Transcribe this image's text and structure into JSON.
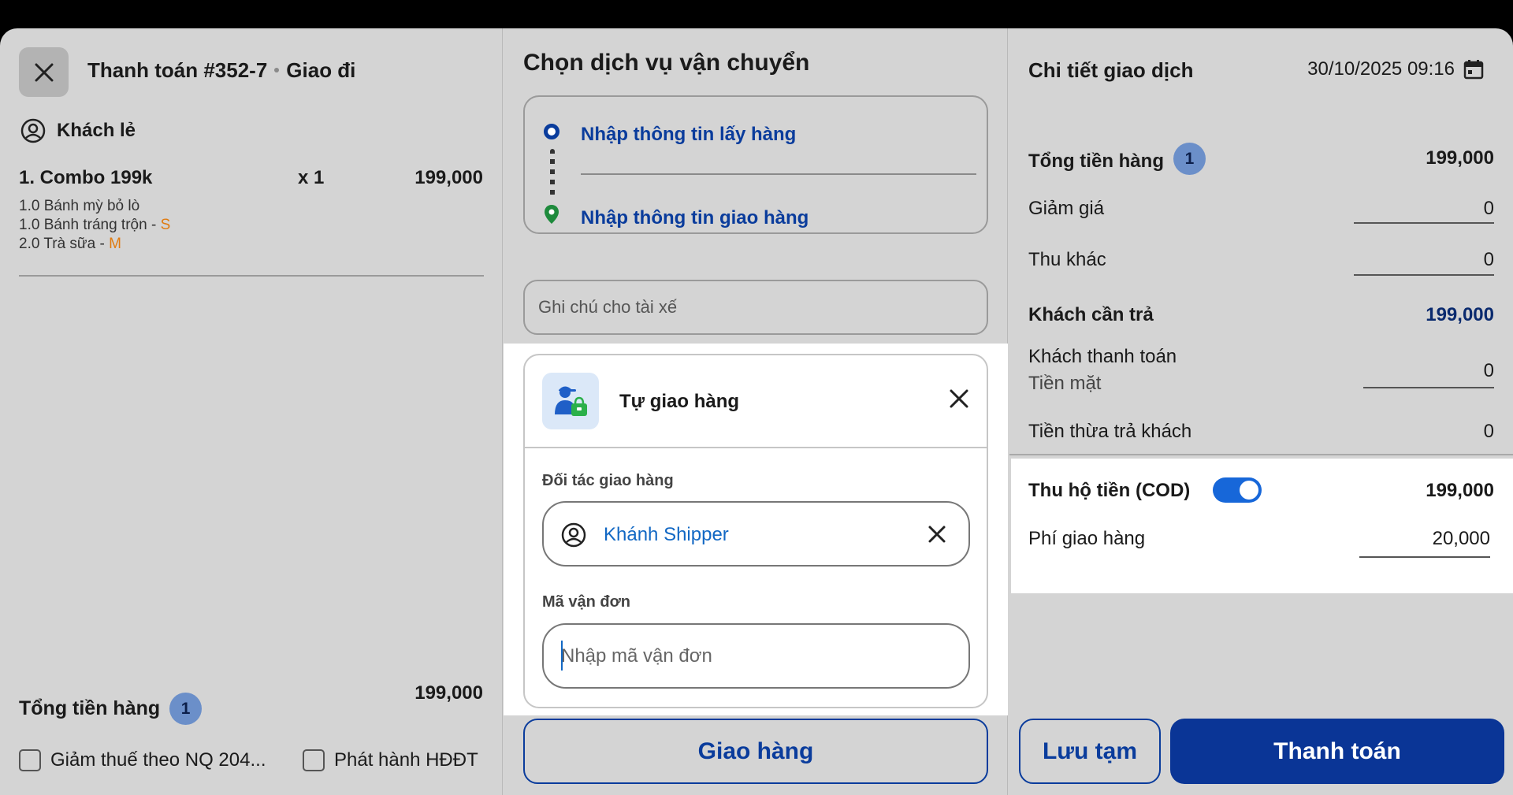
{
  "header": {
    "title": "Thanh toán #352-7",
    "mode": "Giao đi",
    "customer": "Khách lẻ"
  },
  "order": {
    "item_name": "1. Combo 199k",
    "item_qty": "x 1",
    "item_price": "199,000",
    "subitems": [
      {
        "text": "1.0 Bánh mỳ bỏ lò",
        "option": ""
      },
      {
        "text": "1.0 Bánh tráng trộn - ",
        "option": "S"
      },
      {
        "text": "2.0 Trà sữa - ",
        "option": "M"
      }
    ],
    "total_label": "Tổng tiền hàng",
    "total_count": "1",
    "total_value": "199,000",
    "tax_checkbox": "Giảm thuế theo NQ 204...",
    "invoice_checkbox": "Phát hành HĐĐT"
  },
  "shipping": {
    "title": "Chọn dịch vụ vận chuyển",
    "pickup_label": "Nhập thông tin lấy hàng",
    "delivery_label": "Nhập thông tin giao hàng",
    "driver_note_placeholder": "Ghi chú cho tài xế",
    "method_title": "Tự giao hàng",
    "partner_label": "Đối tác giao hàng",
    "partner_name": "Khánh Shipper",
    "waybill_label": "Mã vận đơn",
    "waybill_placeholder": "Nhập mã vận đơn",
    "ship_button": "Giao hàng"
  },
  "transaction": {
    "title": "Chi tiết giao dịch",
    "datetime": "30/10/2025 09:16",
    "subtotal_label": "Tổng tiền hàng",
    "subtotal_count": "1",
    "subtotal_value": "199,000",
    "discount_label": "Giảm giá",
    "discount_value": "0",
    "other_label": "Thu khác",
    "other_value": "0",
    "due_label": "Khách cần trả",
    "due_value": "199,000",
    "paid_label": "Khách thanh toán",
    "paid_method": "Tiền mặt",
    "paid_value": "0",
    "change_label": "Tiền thừa trả khách",
    "change_value": "0",
    "cod_label": "Thu hộ tiền (COD)",
    "cod_enabled": true,
    "cod_value": "199,000",
    "fee_label": "Phí giao hàng",
    "fee_value": "20,000",
    "save_button": "Lưu tạm",
    "pay_button": "Thanh toán"
  },
  "colors": {
    "brand": "#0a3596",
    "link": "#1268c4",
    "option": "#e07b10",
    "toggle": "#1767d9"
  }
}
